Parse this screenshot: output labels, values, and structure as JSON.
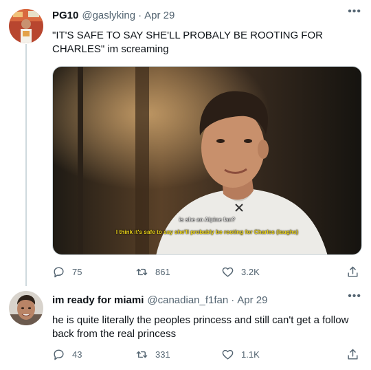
{
  "tweets": [
    {
      "display_name": "PG10",
      "handle": "@gaslyking",
      "separator": "·",
      "date": "Apr 29",
      "text": "\"IT'S SAFE TO SAY SHE'LL PROBALY BE ROOTING FOR CHARLES\" im screaming",
      "media": {
        "subtitle_line_1": "is she an Alpine fan?",
        "subtitle_line_2": "I think it's safe to say she'll probably be rooting for Charles (laughs)"
      },
      "actions": {
        "replies": "75",
        "retweets": "861",
        "likes": "3.2K"
      },
      "more_label": "•••"
    },
    {
      "display_name": "im ready for miami",
      "handle": "@canadian_f1fan",
      "separator": "·",
      "date": "Apr 29",
      "text": "he is quite literally the peoples princess and still can't get a follow back from the real princess",
      "actions": {
        "replies": "43",
        "retweets": "331",
        "likes": "1.1K"
      },
      "more_label": "•••"
    }
  ],
  "colors": {
    "text": "#0f1419",
    "secondary": "#536471",
    "thread_line": "#cfd9de",
    "subtitle_yellow": "#f2d91a"
  },
  "icons": [
    "reply-icon",
    "retweet-icon",
    "like-icon",
    "share-icon",
    "more-icon"
  ]
}
